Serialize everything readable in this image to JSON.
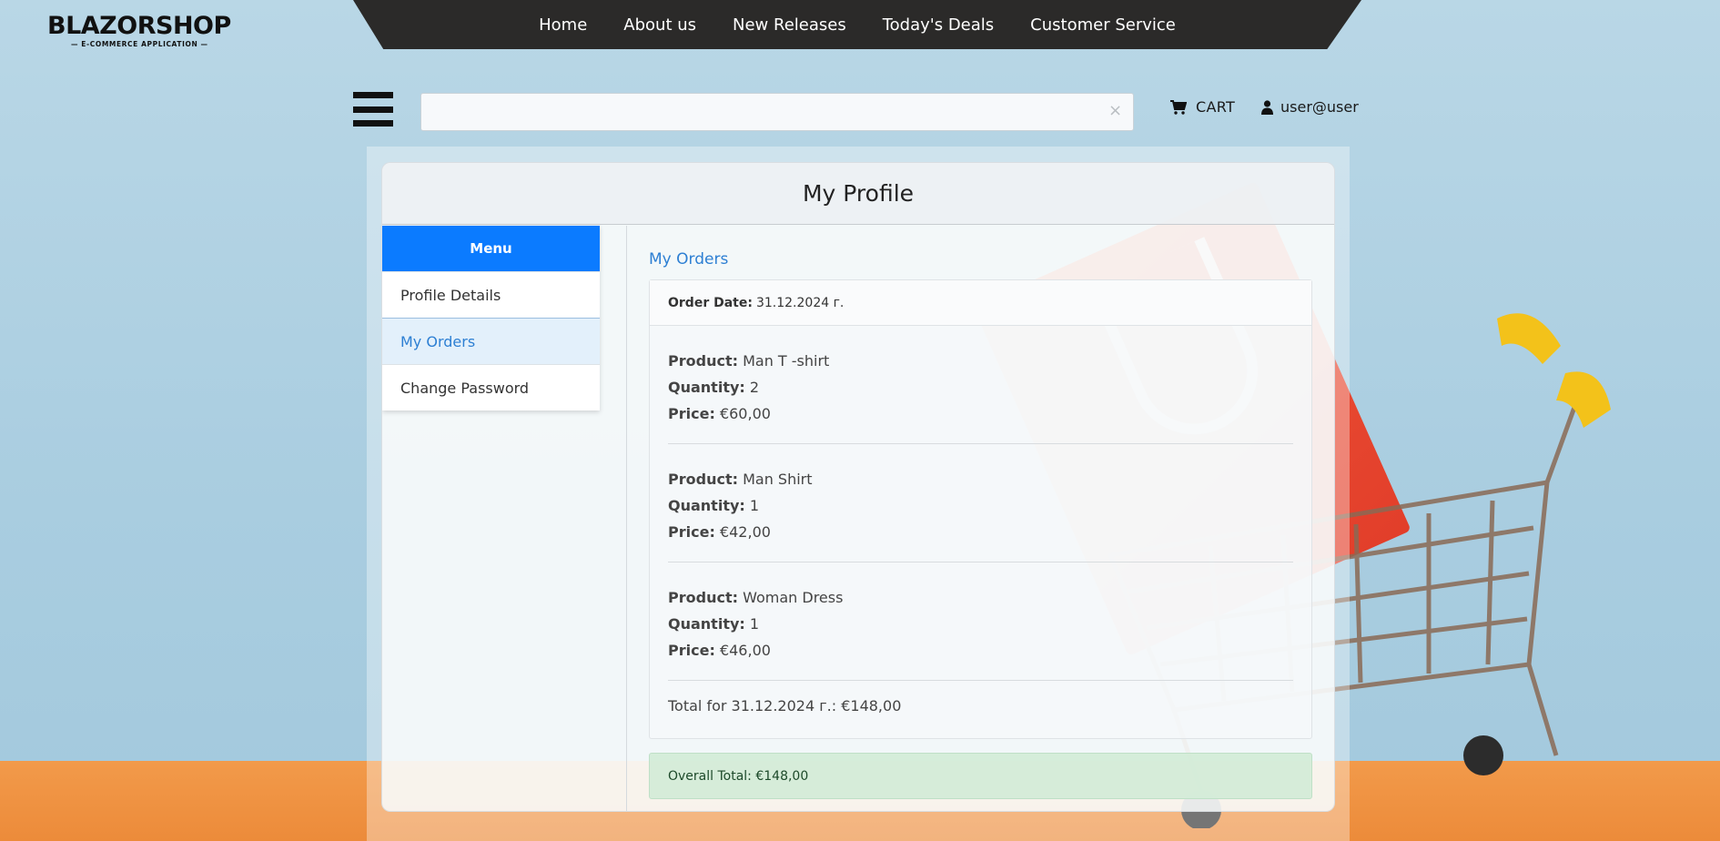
{
  "logo": {
    "main": "BLAZORSHOP",
    "sub": "— E-COMMERCE APPLICATION —"
  },
  "nav": {
    "items": [
      {
        "label": "Home"
      },
      {
        "label": "About us"
      },
      {
        "label": "New Releases"
      },
      {
        "label": "Today's Deals"
      },
      {
        "label": "Customer Service"
      }
    ]
  },
  "search": {
    "value": "",
    "clear_glyph": "×"
  },
  "header_actions": {
    "cart_label": "CART",
    "user_label": "user@user"
  },
  "page": {
    "title": "My Profile"
  },
  "sidebar": {
    "menu_title": "Menu",
    "items": [
      {
        "label": "Profile Details",
        "active": false
      },
      {
        "label": "My Orders",
        "active": true
      },
      {
        "label": "Change Password",
        "active": false
      }
    ]
  },
  "orders": {
    "section_title": "My Orders",
    "date_label": "Order Date:",
    "date_value": "31.12.2024 г.",
    "field_labels": {
      "product": "Product:",
      "quantity": "Quantity:",
      "price": "Price:"
    },
    "items": [
      {
        "product": "Man T -shirt",
        "quantity": "2",
        "price": "€60,00"
      },
      {
        "product": "Man Shirt",
        "quantity": "1",
        "price": "€42,00"
      },
      {
        "product": "Woman Dress",
        "quantity": "1",
        "price": "€46,00"
      }
    ],
    "order_total": "Total for 31.12.2024 г.: €148,00",
    "overall_total": "Overall Total: €148,00"
  },
  "colors": {
    "accent": "#0b7bff",
    "link": "#2d7fd3",
    "nav_bg": "#2b2a29",
    "success_bg": "#d2ecd7"
  },
  "icons": [
    "hamburger-icon",
    "close-icon",
    "cart-icon",
    "user-icon"
  ]
}
